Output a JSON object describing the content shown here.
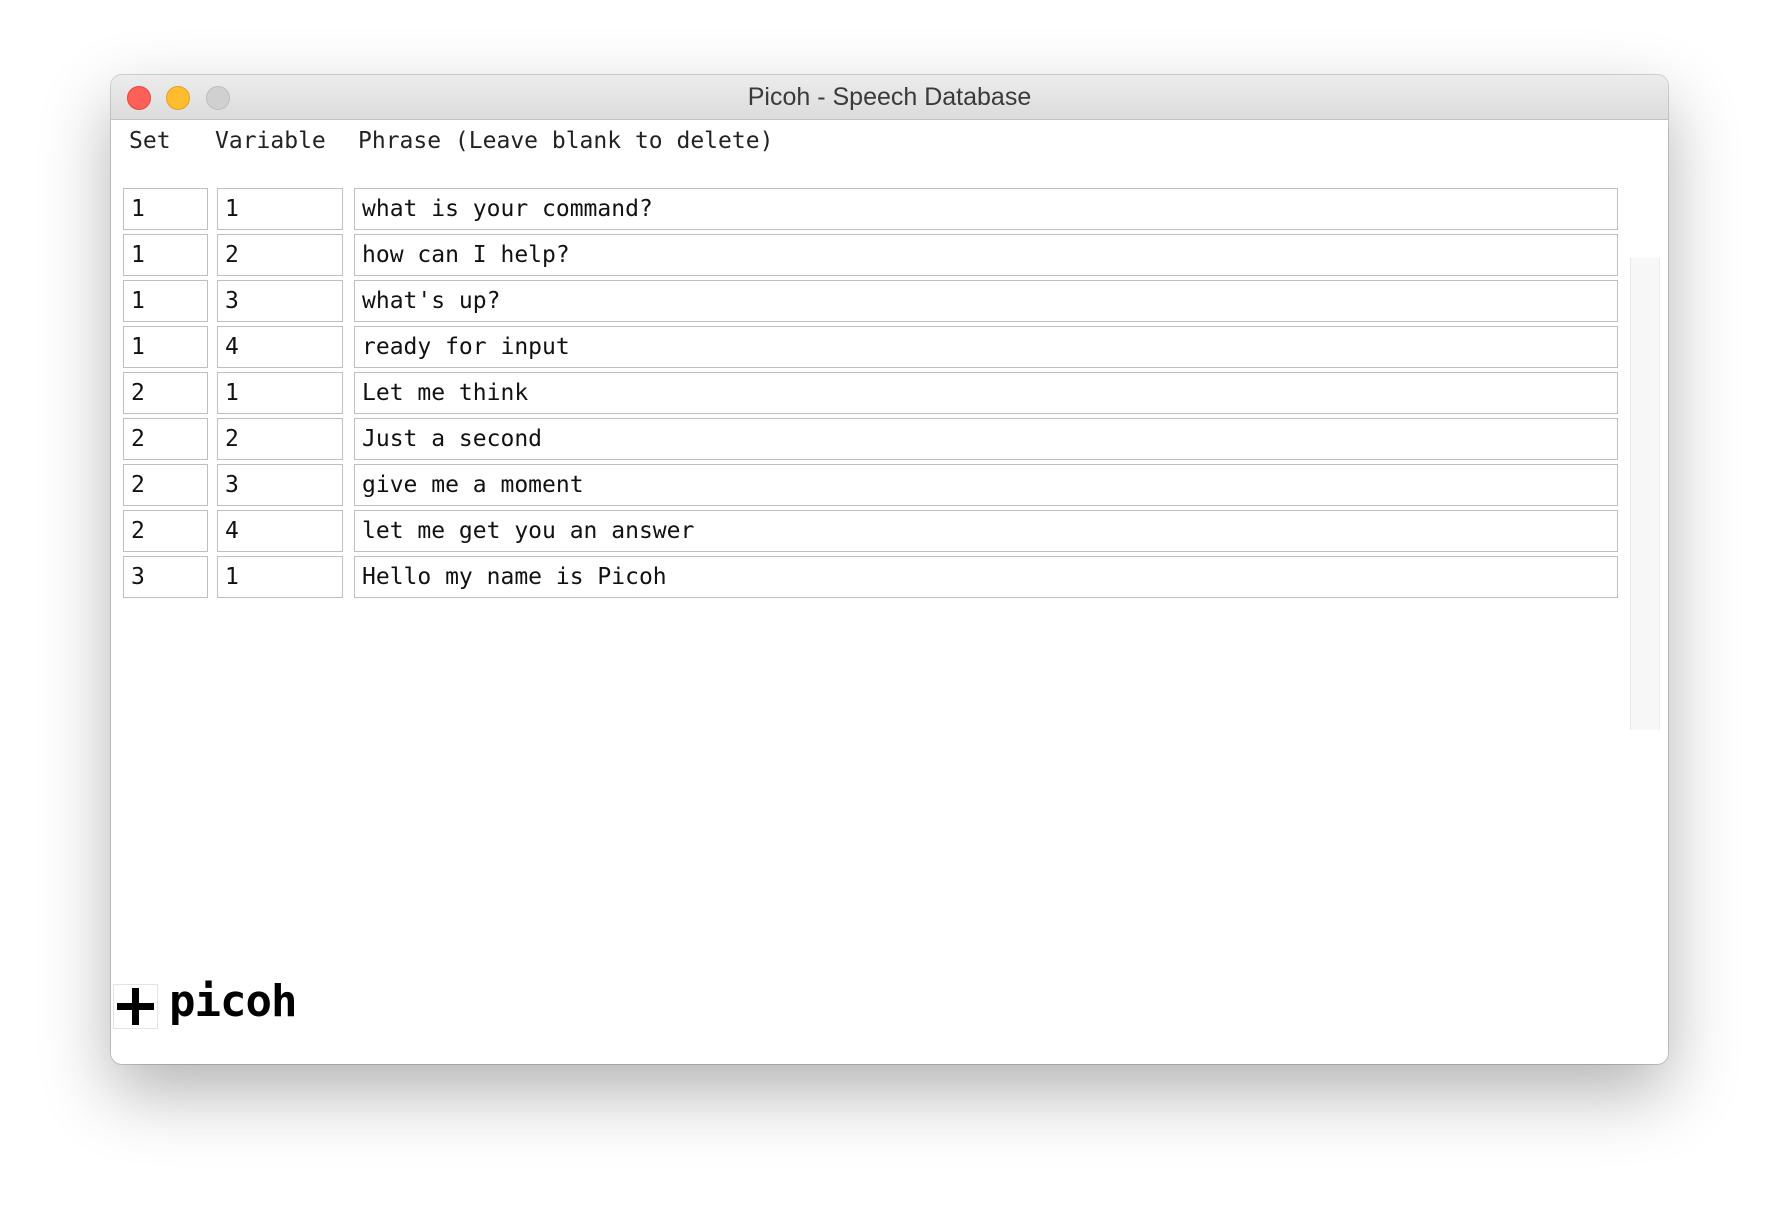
{
  "window": {
    "title": "Picoh - Speech Database"
  },
  "header": {
    "set_label": "Set",
    "variable_label": "Variable",
    "phrase_label": "Phrase (Leave blank to delete)"
  },
  "rows": [
    {
      "set": "1",
      "variable": "1",
      "phrase": "what is your command?"
    },
    {
      "set": "1",
      "variable": "2",
      "phrase": "how can I help?"
    },
    {
      "set": "1",
      "variable": "3",
      "phrase": "what's up?"
    },
    {
      "set": "1",
      "variable": "4",
      "phrase": "ready for input"
    },
    {
      "set": "2",
      "variable": "1",
      "phrase": "Let me think"
    },
    {
      "set": "2",
      "variable": "2",
      "phrase": "Just a second"
    },
    {
      "set": "2",
      "variable": "3",
      "phrase": "give me a moment"
    },
    {
      "set": "2",
      "variable": "4",
      "phrase": "let me get you an answer"
    },
    {
      "set": "3",
      "variable": "1",
      "phrase": "Hello my name is Picoh"
    }
  ],
  "footer": {
    "add_icon": "plus-icon",
    "logo_text": "picoh"
  },
  "colors": {
    "close": "#fe5f57",
    "minimize": "#febc2e",
    "zoom": "#d0d0d0"
  }
}
